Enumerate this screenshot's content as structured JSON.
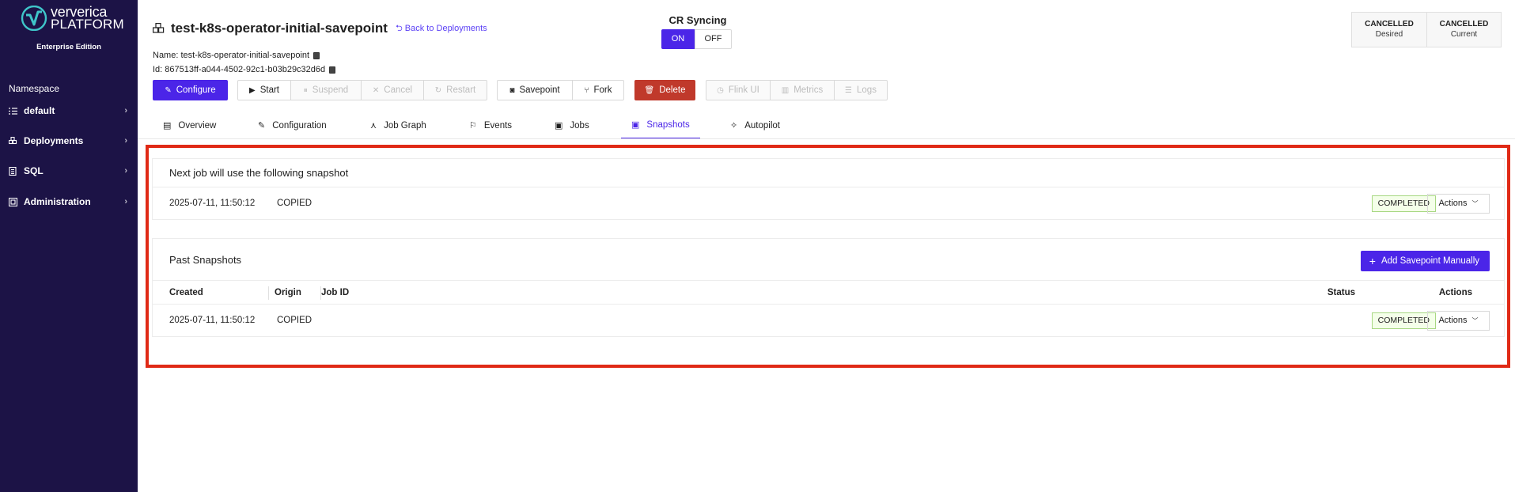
{
  "sidebar": {
    "logo_line1": "ververica",
    "logo_line2": "PLATFORM",
    "edition": "Enterprise Edition",
    "namespace_label": "Namespace",
    "items": [
      {
        "label": "default",
        "icon": "list-icon"
      },
      {
        "label": "Deployments",
        "icon": "deployments-icon"
      },
      {
        "label": "SQL",
        "icon": "sql-icon"
      },
      {
        "label": "Administration",
        "icon": "admin-icon"
      }
    ],
    "colors": {
      "background": "#1c1346"
    }
  },
  "header": {
    "title": "test-k8s-operator-initial-savepoint",
    "back_link": "Back to Deployments",
    "name_line": "Name: test-k8s-operator-initial-savepoint",
    "id_line": "Id: 867513ff-a044-4502-92c1-b03b29c32d6d",
    "cr_sync": {
      "label": "CR Syncing",
      "on": "ON",
      "off": "OFF",
      "selected": "ON"
    },
    "state": [
      {
        "value": "CANCELLED",
        "label": "Desired"
      },
      {
        "value": "CANCELLED",
        "label": "Current"
      }
    ]
  },
  "toolbar": {
    "configure": "Configure",
    "start": "Start",
    "suspend": "Suspend",
    "cancel": "Cancel",
    "restart": "Restart",
    "savepoint": "Savepoint",
    "fork": "Fork",
    "delete": "Delete",
    "flink_ui": "Flink UI",
    "metrics": "Metrics",
    "logs": "Logs"
  },
  "tabs": [
    {
      "label": "Overview",
      "icon": "overview-icon"
    },
    {
      "label": "Configuration",
      "icon": "wrench-icon"
    },
    {
      "label": "Job Graph",
      "icon": "graph-icon"
    },
    {
      "label": "Events",
      "icon": "events-icon"
    },
    {
      "label": "Jobs",
      "icon": "jobs-icon"
    },
    {
      "label": "Snapshots",
      "icon": "snapshots-icon",
      "active": true
    },
    {
      "label": "Autopilot",
      "icon": "autopilot-icon"
    }
  ],
  "next_snapshot": {
    "title": "Next job will use the following snapshot",
    "created": "2025-07-11, 11:50:12",
    "origin": "COPIED",
    "status": "COMPLETED",
    "actions": "Actions"
  },
  "past_snapshots": {
    "title": "Past Snapshots",
    "add_button": "Add Savepoint Manually",
    "columns": {
      "created": "Created",
      "origin": "Origin",
      "job_id": "Job ID",
      "status": "Status",
      "actions": "Actions"
    },
    "rows": [
      {
        "created": "2025-07-11, 11:50:12",
        "origin": "COPIED",
        "job_id": "",
        "status": "COMPLETED",
        "actions": "Actions"
      }
    ]
  },
  "colors": {
    "accent": "#4b25e8",
    "danger": "#c0392b",
    "highlight": "#e02a16",
    "status_ok_bg": "#f4ffe9"
  }
}
